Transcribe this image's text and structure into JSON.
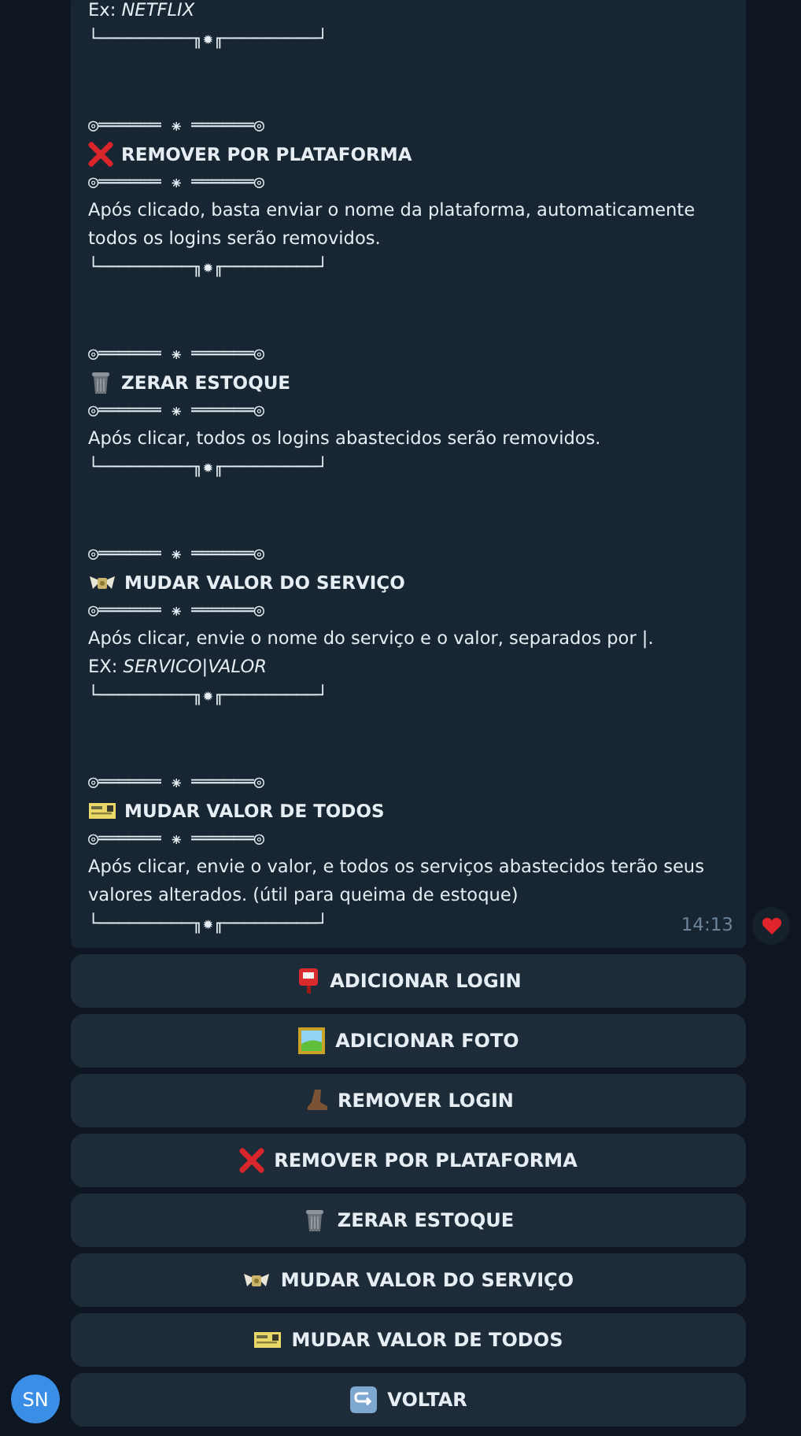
{
  "message": {
    "intro_lines": [
      "Ex: *NETFLIX*"
    ],
    "intro_divider": "└─────────╖✹╓─────────┘",
    "sections": [
      {
        "kind": "cross",
        "top_divider": "◎══════ ⁕ ══════◎",
        "title": "REMOVER POR PLATAFORMA",
        "mid_divider": "◎══════ ⁕ ══════◎",
        "description": [
          "Após clicado, basta enviar o nome da plataforma, automaticamente todos os logins serão removidos."
        ],
        "bottom_divider": "└─────────╖✹╓─────────┘"
      },
      {
        "kind": "trash",
        "top_divider": "◎══════ ⁕ ══════◎",
        "title": "ZERAR ESTOQUE",
        "mid_divider": "◎══════ ⁕ ══════◎",
        "description": [
          "Após clicar, todos os logins abastecidos serão removidos."
        ],
        "bottom_divider": "└─────────╖✹╓─────────┘"
      },
      {
        "kind": "money",
        "top_divider": "◎══════ ⁕ ══════◎",
        "title": "MUDAR VALOR DO SERVIÇO",
        "mid_divider": "◎══════ ⁕ ══════◎",
        "description": [
          "Após clicar, envie o nome do serviço e o valor, separados por |.",
          "EX: *SERVICO|VALOR*"
        ],
        "bottom_divider": "└─────────╖✹╓─────────┘"
      },
      {
        "kind": "ticket",
        "top_divider": "◎══════ ⁕ ══════◎",
        "title": "MUDAR VALOR DE TODOS",
        "mid_divider": "◎══════ ⁕ ══════◎",
        "description": [
          "Após clicar, envie o valor, e todos os serviços abastecidos terão seus valores alterados. (útil para queima de estoque)"
        ],
        "bottom_divider": "└─────────╖✹╓─────────┘"
      }
    ],
    "time": "14:13",
    "reaction": {
      "kind": "heart"
    }
  },
  "buttons": [
    {
      "kind": "mailbox",
      "label": "ADICIONAR LOGIN"
    },
    {
      "kind": "frame",
      "label": "ADICIONAR FOTO"
    },
    {
      "kind": "boot",
      "label": "REMOVER LOGIN"
    },
    {
      "kind": "cross",
      "label": "REMOVER POR PLATAFORMA"
    },
    {
      "kind": "trash",
      "label": "ZERAR ESTOQUE"
    },
    {
      "kind": "money",
      "label": "MUDAR VALOR DO SERVIÇO"
    },
    {
      "kind": "ticket",
      "label": "MUDAR VALOR DE TODOS"
    },
    {
      "kind": "return",
      "label": "VOLTAR"
    }
  ],
  "avatar": {
    "initials": "SN"
  }
}
